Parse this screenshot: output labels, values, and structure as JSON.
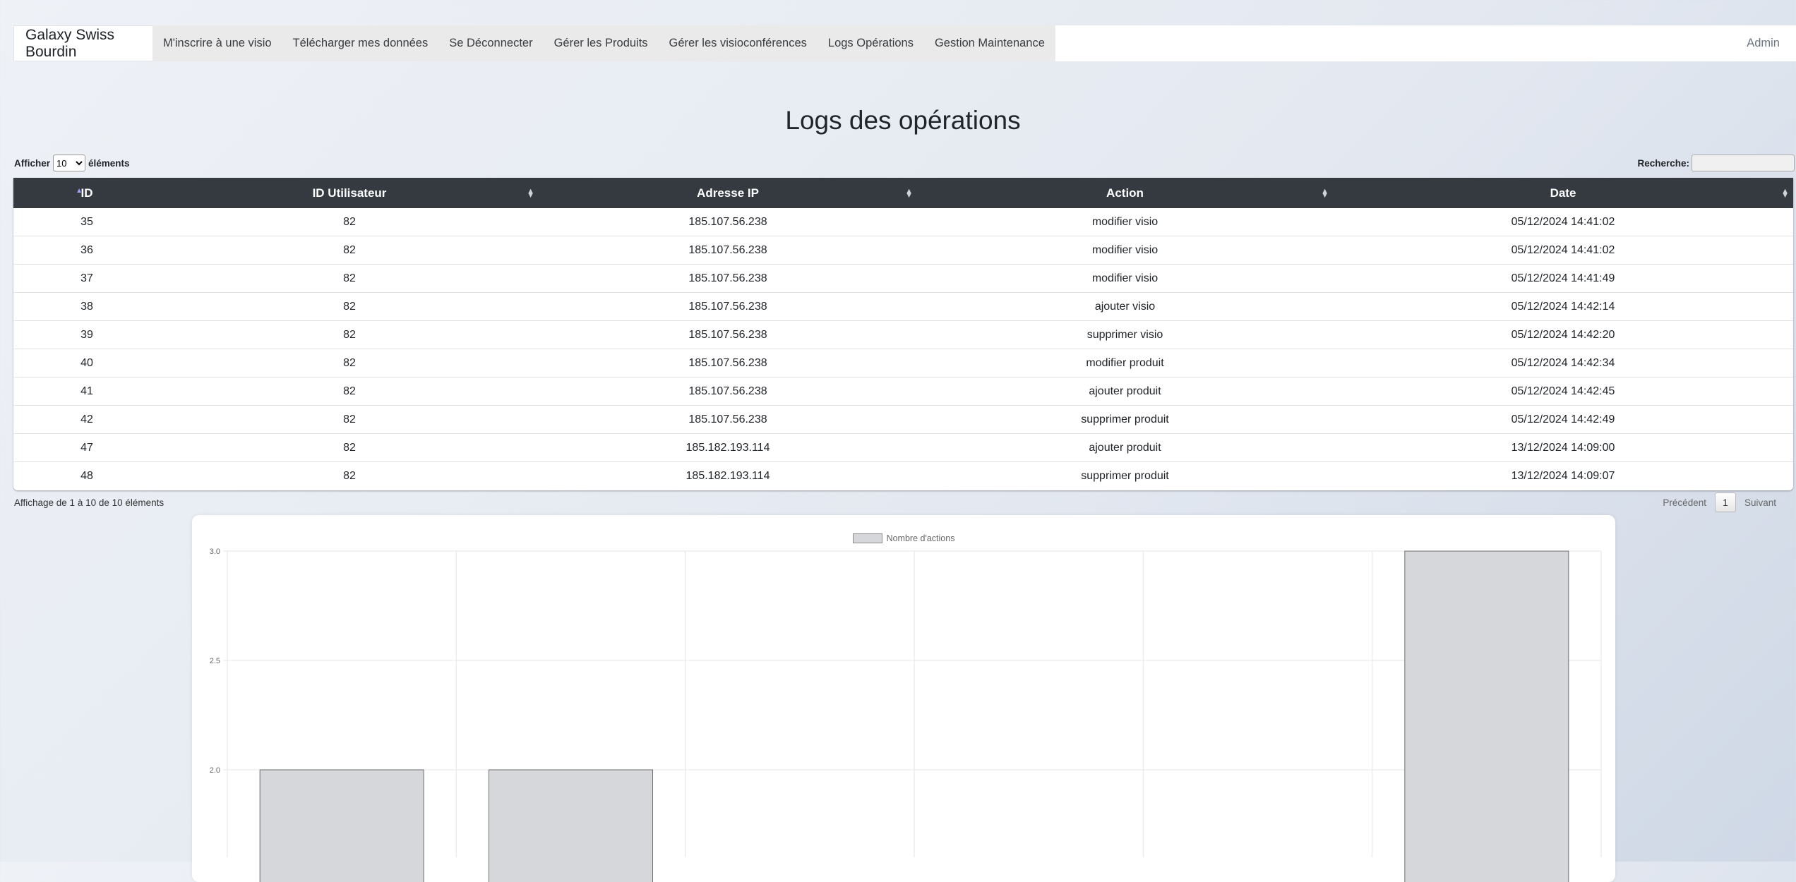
{
  "nav": {
    "brand": "Galaxy Swiss Bourdin",
    "links": [
      "M'inscrire à une visio",
      "Télécharger mes données",
      "Se Déconnecter",
      "Gérer les Produits",
      "Gérer les visioconférences",
      "Logs Opérations",
      "Gestion Maintenance"
    ],
    "user": "Admin"
  },
  "page": {
    "title": "Logs des opérations"
  },
  "datatable": {
    "length_prefix": "Afficher",
    "length_value": "10",
    "length_suffix": "éléments",
    "search_label": "Recherche:",
    "search_value": "",
    "columns": [
      "ID",
      "ID Utilisateur",
      "Adresse IP",
      "Action",
      "Date"
    ],
    "rows": [
      [
        "35",
        "82",
        "185.107.56.238",
        "modifier visio",
        "05/12/2024 14:41:02"
      ],
      [
        "36",
        "82",
        "185.107.56.238",
        "modifier visio",
        "05/12/2024 14:41:02"
      ],
      [
        "37",
        "82",
        "185.107.56.238",
        "modifier visio",
        "05/12/2024 14:41:49"
      ],
      [
        "38",
        "82",
        "185.107.56.238",
        "ajouter visio",
        "05/12/2024 14:42:14"
      ],
      [
        "39",
        "82",
        "185.107.56.238",
        "supprimer visio",
        "05/12/2024 14:42:20"
      ],
      [
        "40",
        "82",
        "185.107.56.238",
        "modifier produit",
        "05/12/2024 14:42:34"
      ],
      [
        "41",
        "82",
        "185.107.56.238",
        "ajouter produit",
        "05/12/2024 14:42:45"
      ],
      [
        "42",
        "82",
        "185.107.56.238",
        "supprimer produit",
        "05/12/2024 14:42:49"
      ],
      [
        "47",
        "82",
        "185.182.193.114",
        "ajouter produit",
        "13/12/2024 14:09:00"
      ],
      [
        "48",
        "82",
        "185.182.193.114",
        "supprimer produit",
        "13/12/2024 14:09:07"
      ]
    ],
    "info": "Affichage de 1 à 10 de 10 éléments",
    "prev_label": "Précédent",
    "current_page": "1",
    "next_label": "Suivant"
  },
  "chart_data": {
    "type": "bar",
    "categories": [
      "",
      "",
      "",
      "",
      "",
      ""
    ],
    "series": [
      {
        "name": "Nombre d'actions",
        "values": [
          2,
          2,
          0,
          0,
          0,
          3
        ]
      }
    ],
    "ylim": [
      1.6,
      3.0
    ],
    "yticks": [
      2.0,
      2.5,
      3.0
    ],
    "grid": true,
    "legend": "top-center",
    "colors": {
      "bar_fill": "#d6d7da",
      "bar_stroke": "#6e6e6e",
      "grid": "#e5e5e5"
    }
  }
}
